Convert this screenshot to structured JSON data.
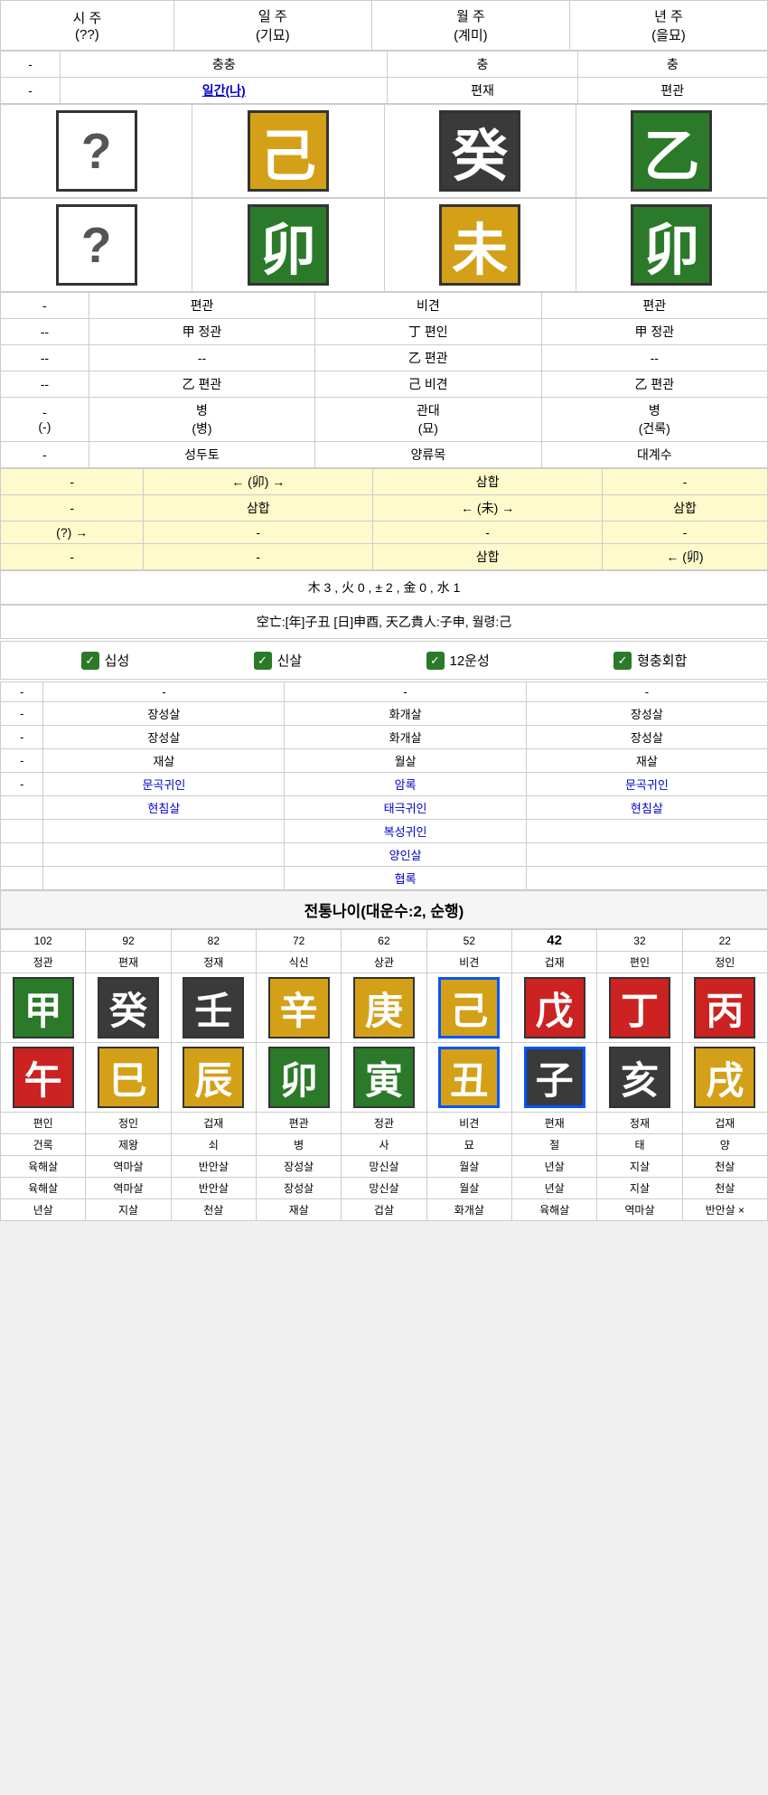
{
  "columns": {
    "siju": {
      "top": "시 주",
      "sub": "(??)"
    },
    "ilju": {
      "top": "일 주",
      "sub": "(기묘)"
    },
    "wolju": {
      "top": "월 주",
      "sub": "(계미)"
    },
    "nyeonju": {
      "top": "년 주",
      "sub": "(을묘)"
    }
  },
  "row_chung": {
    "siju": "-",
    "ilju": "충충",
    "wolju": "충",
    "nyeonju": "충"
  },
  "row_ilgan": {
    "siju": "-",
    "ilju": "일간(나)",
    "wolju": "편재",
    "nyeonju": "편관"
  },
  "chars_top": {
    "siju": "?",
    "ilju": "己",
    "wolju": "癸",
    "nyeonju": "乙"
  },
  "chars_bottom": {
    "siju": "?",
    "ilju": "卯",
    "wolju": "未",
    "nyeonju": "卯"
  },
  "row_sipsung": {
    "siju": "-",
    "ilju": "편관",
    "wolju": "비견",
    "nyeonju": "편관"
  },
  "row_jungsin1": {
    "siju": "--",
    "ilju": "甲 정관",
    "wolju": "丁 편인",
    "nyeonju": "甲 정관"
  },
  "row_jungsin2": {
    "siju": "--",
    "ilju": "--",
    "wolju": "乙 편관",
    "nyeonju": "--"
  },
  "row_jungsin3": {
    "siju": "--",
    "ilju": "乙 편관",
    "wolju": "己 비견",
    "nyeonju": "乙 편관"
  },
  "row_byeong": {
    "siju": "-",
    "siju2": "(-)",
    "ilju": "병",
    "ilju2": "(병)",
    "wolju": "관대",
    "wolju2": "(묘)",
    "nyeonju": "병",
    "nyeonju2": "(건록)"
  },
  "row_sungdu": {
    "siju": "-",
    "ilju": "성두토",
    "wolju": "양류목",
    "nyeonju": "대계수"
  },
  "yellow_rows": [
    {
      "siju": "-",
      "ilju": "← (卯) →",
      "wolju": "삼합",
      "nyeonju": "-"
    },
    {
      "siju": "-",
      "ilju": "삼합",
      "wolju": "← (未) →",
      "nyeonju": "삼합"
    },
    {
      "siju": "(?) →",
      "ilju": "-",
      "wolju": "-",
      "nyeonju": "-"
    },
    {
      "siju": "-",
      "ilju": "-",
      "wolju": "삼합",
      "nyeonju": "← (卯)"
    }
  ],
  "summary1": "木 3 , 火 0 , ± 2 , 金 0 , 水 1",
  "summary2": "空亡:[年]子丑 [日]申酉, 天乙貴人:子申, 월령:己",
  "checkboxes": [
    {
      "label": "십성",
      "checked": true
    },
    {
      "label": "신살",
      "checked": true
    },
    {
      "label": "12운성",
      "checked": true
    },
    {
      "label": "형충회합",
      "checked": true
    }
  ],
  "shinsal_rows": [
    {
      "siju": "-",
      "ilju": "-",
      "wolju": "-",
      "nyeonju": "-"
    },
    {
      "siju": "-",
      "ilju": "장성살",
      "wolju": "화개살",
      "nyeonju": "장성살"
    },
    {
      "siju": "-",
      "ilju": "장성살",
      "wolju": "화개살",
      "nyeonju": "장성살"
    },
    {
      "siju": "-",
      "ilju": "재살",
      "wolju": "월살",
      "nyeonju": "재살"
    },
    {
      "siju": "-",
      "ilju": "문곡귀인",
      "wolju": "암록",
      "nyeonju": "문곡귀인"
    },
    {
      "siju_extra": "",
      "ilju": "현침살",
      "wolju": "태극귀인",
      "nyeonju": "현침살"
    },
    {
      "siju_extra": "",
      "ilju": "",
      "wolju": "복성귀인",
      "nyeonju": ""
    },
    {
      "siju_extra": "",
      "ilju": "",
      "wolju": "양인살",
      "nyeonju": ""
    },
    {
      "siju_extra": "",
      "ilju": "",
      "wolju": "협록",
      "nyeonju": ""
    }
  ],
  "daeun_header": "전통나이(대운수:2, 순행)",
  "daeun_ages": [
    "102",
    "92",
    "82",
    "72",
    "62",
    "52",
    "42",
    "32",
    "22"
  ],
  "daeun_sipsung": [
    "정관",
    "편재",
    "정재",
    "식신",
    "상관",
    "비견",
    "겁재",
    "편인",
    "정인"
  ],
  "daeun_top_chars": [
    {
      "char": "甲",
      "color": "green"
    },
    {
      "char": "癸",
      "color": "dark"
    },
    {
      "char": "壬",
      "color": "dark"
    },
    {
      "char": "辛",
      "color": "yellow"
    },
    {
      "char": "庚",
      "color": "yellow"
    },
    {
      "char": "己",
      "color": "yellow",
      "highlight": true
    },
    {
      "char": "戊",
      "color": "red"
    },
    {
      "char": "丁",
      "color": "red"
    },
    {
      "char": "丙",
      "color": "red"
    }
  ],
  "daeun_bottom_chars": [
    {
      "char": "午",
      "color": "red"
    },
    {
      "char": "巳",
      "color": "yellow"
    },
    {
      "char": "辰",
      "color": "yellow"
    },
    {
      "char": "卯",
      "color": "green"
    },
    {
      "char": "寅",
      "color": "green"
    },
    {
      "char": "丑",
      "color": "yellow",
      "highlight": true
    },
    {
      "char": "子",
      "color": "dark",
      "highlight": true
    },
    {
      "char": "亥",
      "color": "dark"
    },
    {
      "char": "戌",
      "color": "yellow"
    }
  ],
  "daeun_sipsung2_top": [
    "편인",
    "정인",
    "겁재",
    "편관",
    "정관",
    "비견",
    "편재",
    "정재",
    "겁재"
  ],
  "daeun_sipsung2_bottom": [
    "건록",
    "제왕",
    "쇠",
    "병",
    "사",
    "묘",
    "절",
    "태",
    "양"
  ],
  "daeun_shinsal1": [
    "육해살",
    "역마살",
    "반안살",
    "장성살",
    "망신살",
    "월살",
    "년살",
    "지살",
    "천살"
  ],
  "daeun_shinsal2": [
    "육해살",
    "역마살",
    "반안살",
    "장성살",
    "망신살",
    "월살",
    "년살",
    "지살",
    "천살"
  ],
  "daeun_shinsal3": [
    "년살",
    "지살",
    "천살",
    "재살",
    "겁살",
    "화개살",
    "육해살",
    "역마살",
    "반안살 ×"
  ]
}
